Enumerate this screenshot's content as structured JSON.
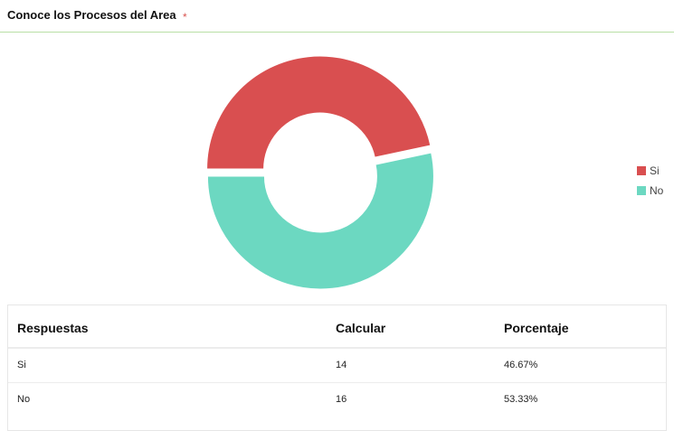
{
  "header": {
    "title": "Conoce los Procesos del Area",
    "required_mark": "*"
  },
  "colors": {
    "si": "#d94f50",
    "no": "#6cd8c1",
    "header_rule": "#b9dfa6"
  },
  "chart_data": {
    "type": "pie",
    "style": "donut",
    "categories": [
      "Si",
      "No"
    ],
    "values": [
      14,
      16
    ],
    "colors": [
      "#d94f50",
      "#6cd8c1"
    ],
    "exploded": true,
    "legend_position": "right"
  },
  "legend": {
    "items": [
      {
        "label": "Si",
        "color": "#d94f50"
      },
      {
        "label": "No",
        "color": "#6cd8c1"
      }
    ]
  },
  "table": {
    "headers": [
      "Respuestas",
      "Calcular",
      "Porcentaje"
    ],
    "rows": [
      [
        "Si",
        "14",
        "46.67%"
      ],
      [
        "No",
        "16",
        "53.33%"
      ]
    ]
  }
}
